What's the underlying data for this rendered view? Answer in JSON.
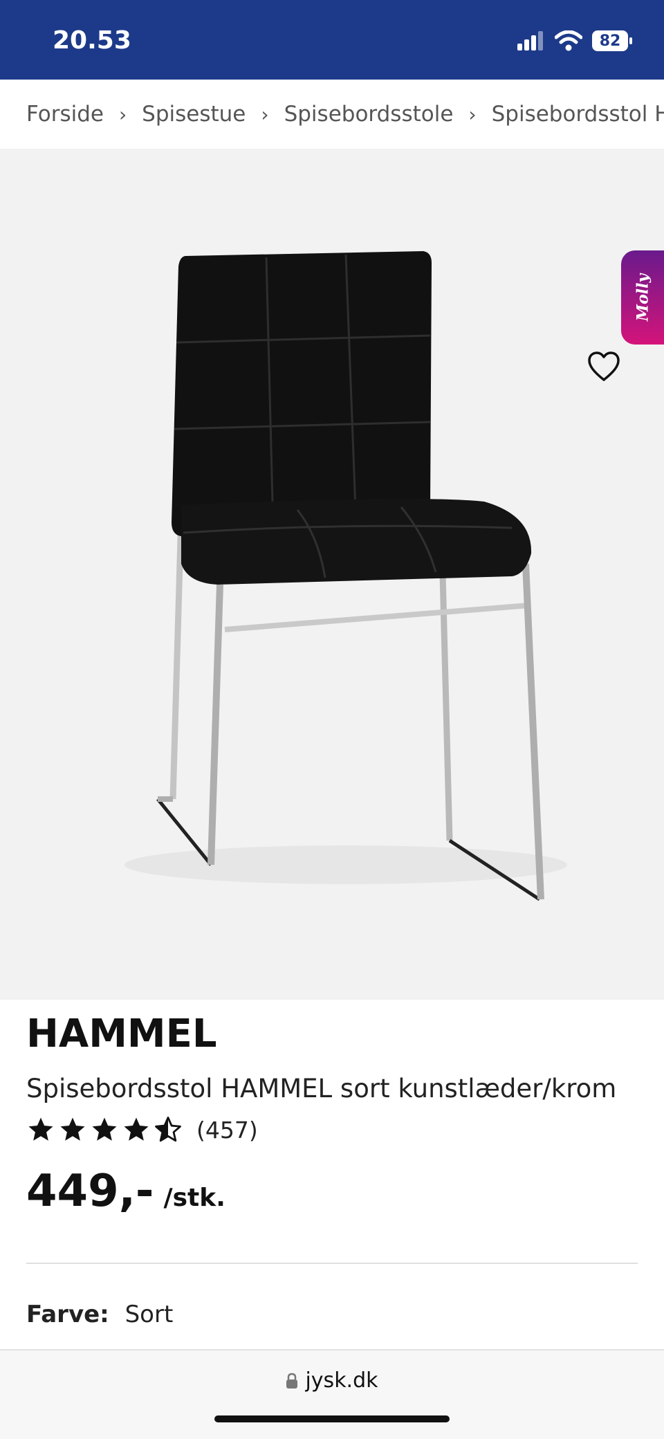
{
  "status": {
    "time": "20.53",
    "battery": "82"
  },
  "breadcrumbs": [
    "Forside",
    "Spisestue",
    "Spisebordsstole",
    "Spisebordsstol HAMMEL"
  ],
  "product": {
    "brand": "HAMMEL",
    "name": "Spisebordsstol HAMMEL sort kunstlæder/krom",
    "rating": 4.5,
    "review_count": "(457)",
    "price": "449,-",
    "price_unit": "/stk.",
    "color_label": "Farve:",
    "color_value": "Sort"
  },
  "gallery": {
    "slides": 2,
    "active_slide": 1
  },
  "chat": {
    "label": "Molly"
  },
  "browser": {
    "url": "jysk.dk"
  },
  "colors": {
    "header_bg": "#1d3a8a",
    "chat_gradient_start": "#6a1a8c",
    "chat_gradient_end": "#d4147a"
  }
}
